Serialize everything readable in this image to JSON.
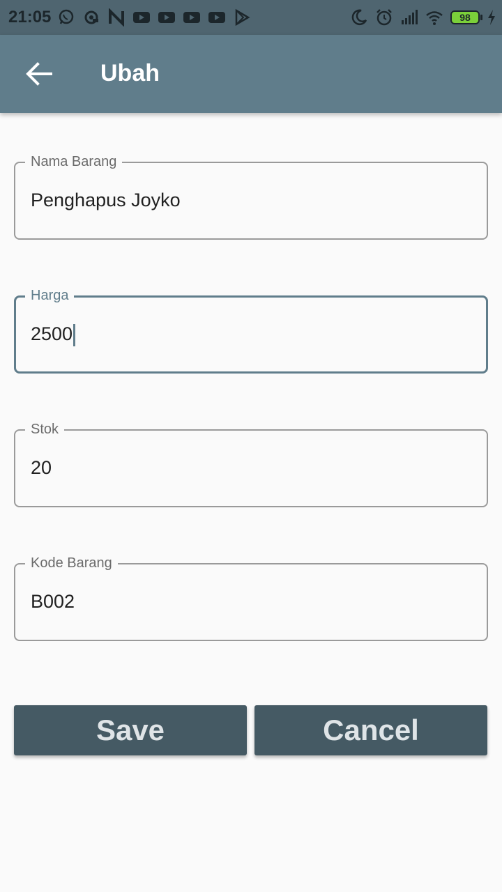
{
  "status_bar": {
    "time": "21:05",
    "left_icons": [
      "whatsapp-icon",
      "sync-icon",
      "n-app-icon",
      "youtube-icon",
      "youtube-icon",
      "youtube-icon",
      "youtube-icon",
      "play-store-icon"
    ],
    "right_icons": [
      "moon-icon",
      "alarm-icon",
      "signal-icon",
      "wifi-icon"
    ],
    "battery_level": "98",
    "charging": true
  },
  "appbar": {
    "back_icon": "arrow-left-icon",
    "title": "Ubah",
    "color": "#607d8b"
  },
  "form": {
    "nama_barang": {
      "label": "Nama Barang",
      "value": "Penghapus Joyko"
    },
    "harga": {
      "label": "Harga",
      "value": "2500",
      "focused": true
    },
    "stok": {
      "label": "Stok",
      "value": "20"
    },
    "kode_barang": {
      "label": "Kode Barang",
      "value": "B002"
    }
  },
  "actions": {
    "save_label": "Save",
    "cancel_label": "Cancel",
    "button_color": "#455a64"
  }
}
